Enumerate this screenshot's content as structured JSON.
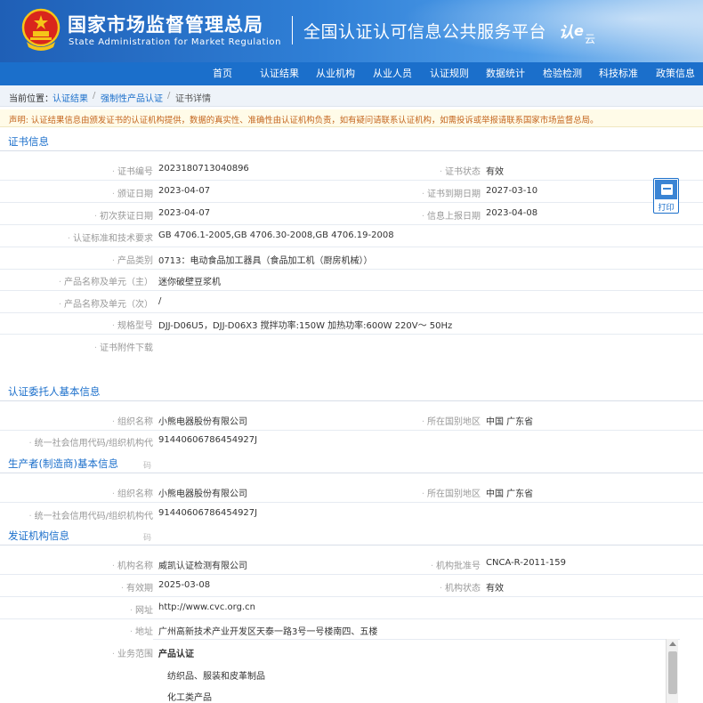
{
  "header": {
    "org_cn": "国家市场监督管理总局",
    "org_en": "State Administration  for  Market Regulation",
    "platform": "全国认证认可信息公共服务平台",
    "logo_text": "认e云"
  },
  "nav": [
    "首页",
    "认证结果",
    "从业机构",
    "从业人员",
    "认证规则",
    "数据统计",
    "检验检测",
    "科技标准",
    "政策信息"
  ],
  "breadcrumb": {
    "current_label": "当前位置：",
    "items": [
      "认证结果",
      "强制性产品认证",
      "证书详情"
    ],
    "separator": "/"
  },
  "notice": "声明: 认证结果信息由颁发证书的认证机构提供，数据的真实性、准确性由认证机构负责，如有疑问请联系认证机构，如需投诉或举报请联系国家市场监督总局。",
  "print_label": "打印",
  "cert_section": {
    "title": "证书信息",
    "cert_no_label": "证书编号",
    "cert_no": "2023180713040896",
    "status_label": "证书状态",
    "status": "有效",
    "issue_label": "颁证日期",
    "issue": "2023-04-07",
    "expire_label": "证书到期日期",
    "expire": "2027-03-10",
    "first_label": "初次获证日期",
    "first": "2023-04-07",
    "report_label": "信息上报日期",
    "report": "2023-04-08",
    "std_label": "认证标准和技术要求",
    "std": "GB 4706.1-2005,GB 4706.30-2008,GB 4706.19-2008",
    "cat_label": "产品类别",
    "cat": "0713：电动食品加工器具（食品加工机（厨房机械））",
    "main_label": "产品名称及单元（主）",
    "main": "迷你破壁豆浆机",
    "sub_label": "产品名称及单元（次）",
    "sub": "/",
    "model_label": "规格型号",
    "model": "DJJ-D06U5，DJJ-D06X3 搅拌功率:150W 加热功率:600W 220V～ 50Hz",
    "attach_label": "证书附件下载"
  },
  "client_section": {
    "title": "认证委托人基本信息",
    "org_label": "组织名称",
    "org": "小熊电器股份有限公司",
    "region_label": "所在国别地区",
    "region": "中国 广东省",
    "code_label": "统一社会信用代码/组织机构代",
    "code": "91440606786454927J"
  },
  "maker_section": {
    "title": "生产者(制造商)基本信息",
    "aux": "码",
    "org_label": "组织名称",
    "org": "小熊电器股份有限公司",
    "region_label": "所在国别地区",
    "region": "中国 广东省",
    "code_label": "统一社会信用代码/组织机构代",
    "code": "91440606786454927J"
  },
  "issuer_section": {
    "title": "发证机构信息",
    "aux": "码",
    "name_label": "机构名称",
    "name": "威凯认证检测有限公司",
    "approval_label": "机构批准号",
    "approval": "CNCA-R-2011-159",
    "valid_label": "有效期",
    "valid": "2025-03-08",
    "state_label": "机构状态",
    "state": "有效",
    "url_label": "网址",
    "url": "http://www.cvc.org.cn",
    "addr_label": "地址",
    "addr": "广州高新技术产业开发区天泰一路3号一号楼南四、五楼",
    "scope_label": "业务范围",
    "scope_heading": "产品认证",
    "scope_items": [
      "纺织品、服装和皮革制品",
      "化工类产品"
    ]
  }
}
